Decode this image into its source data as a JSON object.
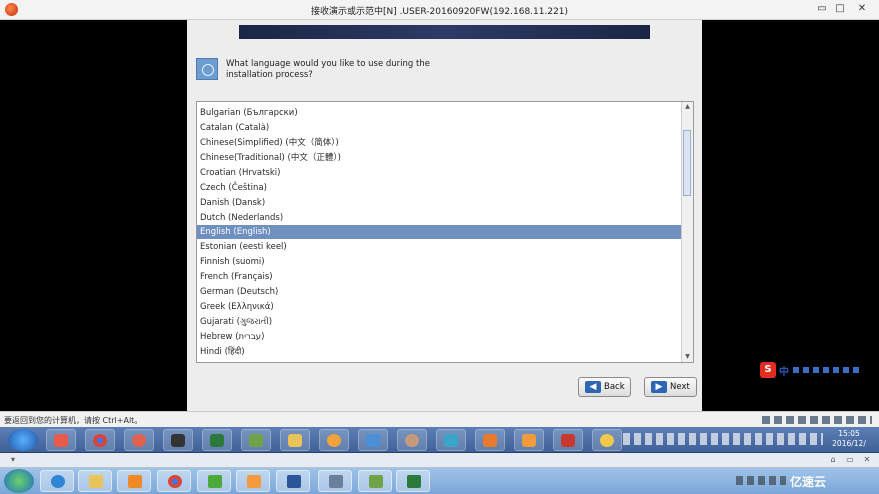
{
  "window": {
    "title": "接收演示或示范中[N] .USER-20160920FW(192.168.11.221)",
    "min_glyph": "▭",
    "max_glyph": "□",
    "close_glyph": "✕"
  },
  "installer": {
    "question": "What language would you like to use during the installation process?",
    "languages": [
      "Bulgarian (Български)",
      "Catalan (Català)",
      "Chinese(Simplified) (中文（简体）)",
      "Chinese(Traditional) (中文（正體）)",
      "Croatian (Hrvatski)",
      "Czech (Čeština)",
      "Danish (Dansk)",
      "Dutch (Nederlands)",
      "English (English)",
      "Estonian (eesti keel)",
      "Finnish (suomi)",
      "French (Français)",
      "German (Deutsch)",
      "Greek (Ελληνικά)",
      "Gujarati (ગુજરાતી)",
      "Hebrew (עברית)",
      "Hindi (हिंदी)"
    ],
    "selected_language": "English (English)",
    "back_label": "Back",
    "next_label": "Next",
    "scroll_up_glyph": "▲",
    "scroll_down_glyph": "▼"
  },
  "ime": {
    "logo": "S",
    "mode": "中"
  },
  "vm_status": {
    "message": "要返回到您的计算机，请按 Ctrl+Alt。"
  },
  "guest_taskbar": {
    "clock_time": "15:05",
    "clock_date": "2016/12/"
  },
  "host_bar": {
    "buttons": [
      "▾",
      "⌂",
      "▭",
      "✕"
    ]
  },
  "host_taskbar": {
    "watermark": "亿速云"
  },
  "colors": {
    "selection": "#6f8fc0",
    "button_arrow": "#2f66b3",
    "banner": "#1b2645"
  }
}
